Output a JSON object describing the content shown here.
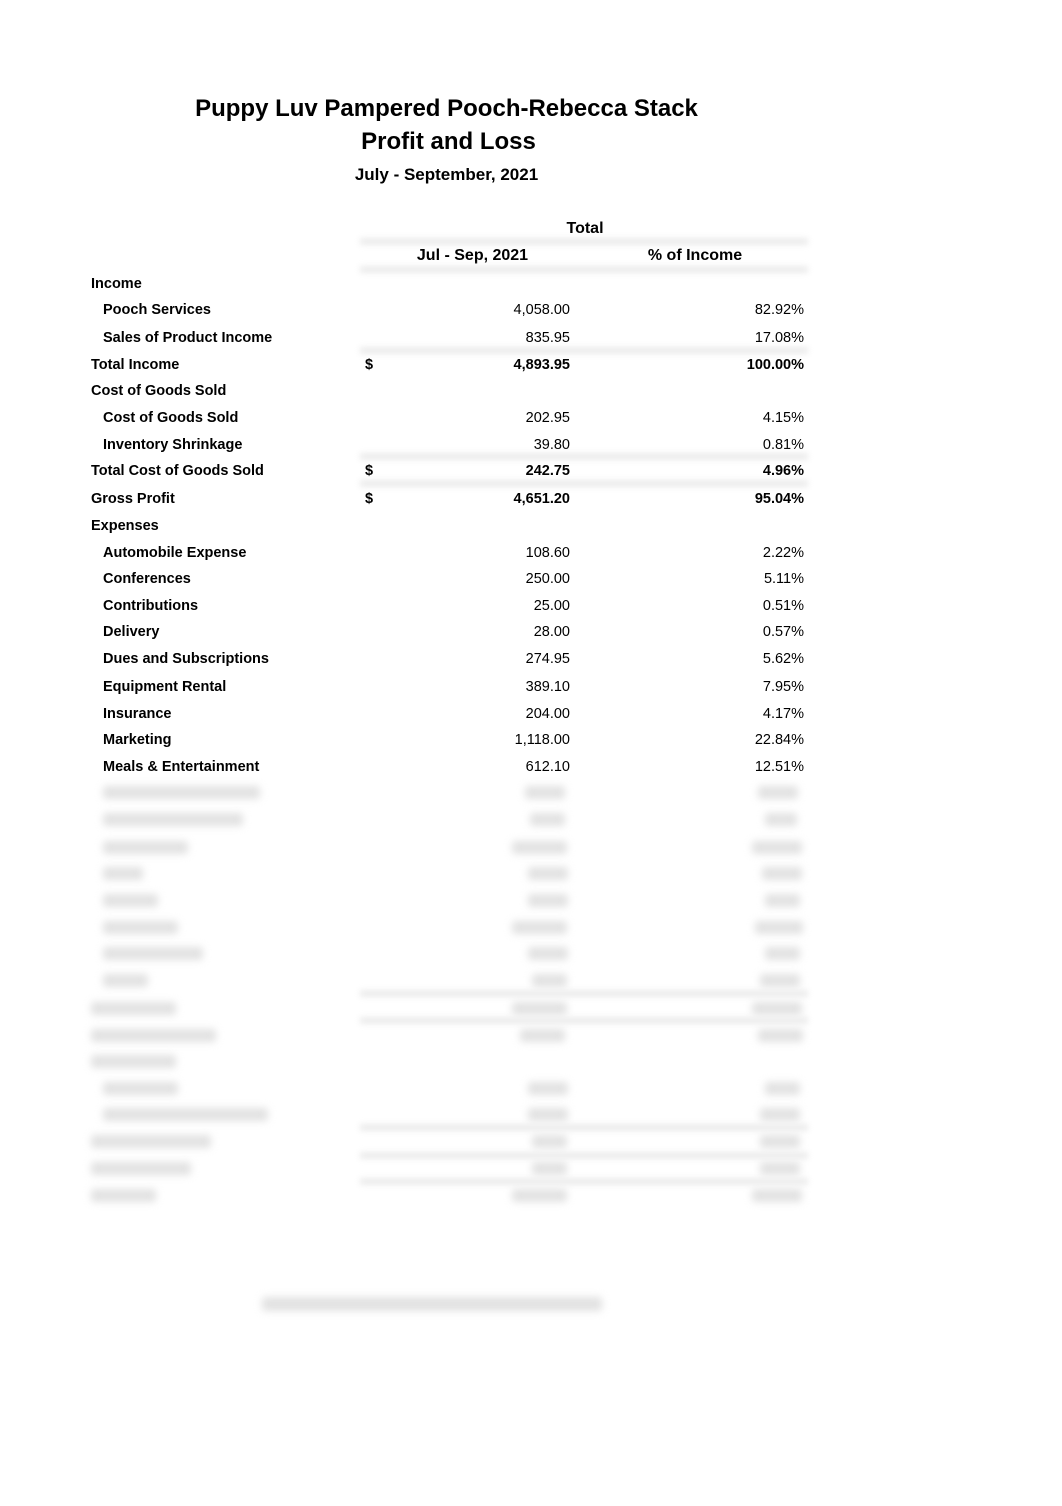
{
  "report": {
    "company": "Puppy Luv Pampered Pooch-Rebecca Stack",
    "title": "Profit and Loss",
    "period": "July - September, 2021"
  },
  "columns": {
    "group_header": "Total",
    "amount_header": "Jul - Sep, 2021",
    "percent_header": "% of Income"
  },
  "rows": [
    {
      "label": "Income",
      "type": "section"
    },
    {
      "label": "Pooch Services",
      "type": "item",
      "amount": "4,058.00",
      "percent": "82.92%"
    },
    {
      "label": "Sales of Product Income",
      "type": "item",
      "amount": "835.95",
      "percent": "17.08%"
    },
    {
      "label": "Total Income",
      "type": "total",
      "currency": "$",
      "amount": "4,893.95",
      "percent": "100.00%"
    },
    {
      "label": "Cost of Goods Sold",
      "type": "section"
    },
    {
      "label": "Cost of Goods Sold",
      "type": "item",
      "amount": "202.95",
      "percent": "4.15%"
    },
    {
      "label": "Inventory Shrinkage",
      "type": "item",
      "amount": "39.80",
      "percent": "0.81%"
    },
    {
      "label": "Total Cost of Goods Sold",
      "type": "total",
      "currency": "$",
      "amount": "242.75",
      "percent": "4.96%"
    },
    {
      "label": "Gross Profit",
      "type": "total",
      "currency": "$",
      "amount": "4,651.20",
      "percent": "95.04%"
    },
    {
      "label": "Expenses",
      "type": "section"
    },
    {
      "label": "Automobile Expense",
      "type": "item",
      "amount": "108.60",
      "percent": "2.22%"
    },
    {
      "label": "Conferences",
      "type": "item",
      "amount": "250.00",
      "percent": "5.11%"
    },
    {
      "label": "Contributions",
      "type": "item",
      "amount": "25.00",
      "percent": "0.51%"
    },
    {
      "label": "Delivery",
      "type": "item",
      "amount": "28.00",
      "percent": "0.57%"
    },
    {
      "label": "Dues and Subscriptions",
      "type": "item",
      "amount": "274.95",
      "percent": "5.62%"
    },
    {
      "label": "Equipment Rental",
      "type": "item",
      "amount": "389.10",
      "percent": "7.95%"
    },
    {
      "label": "Insurance",
      "type": "item",
      "amount": "204.00",
      "percent": "4.17%"
    },
    {
      "label": "Marketing",
      "type": "item",
      "amount": "1,118.00",
      "percent": "22.84%"
    },
    {
      "label": "Meals & Entertainment",
      "type": "item",
      "amount": "612.10",
      "percent": "12.51%"
    }
  ]
}
